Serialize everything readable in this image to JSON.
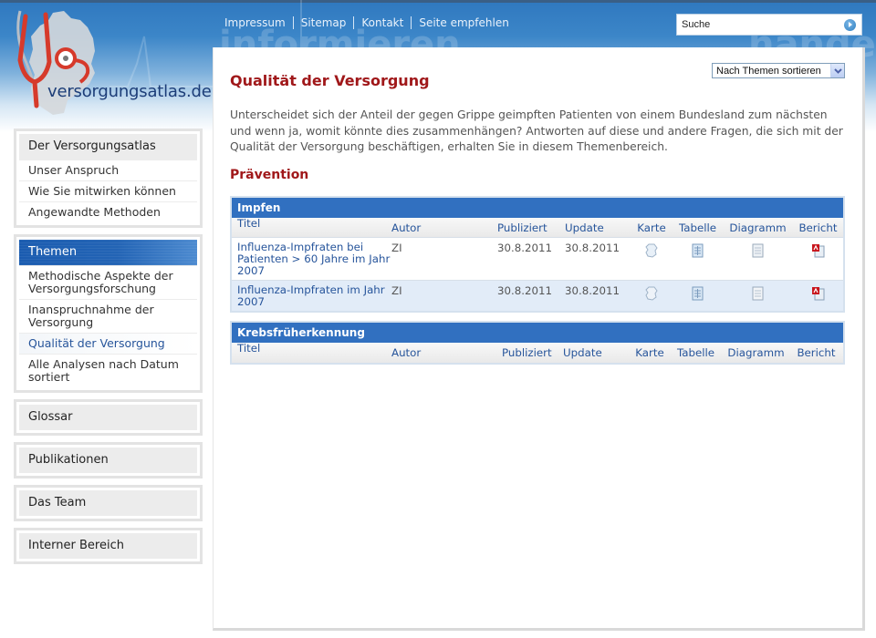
{
  "site": {
    "logo_text": "versorgungsatlas.de"
  },
  "topnav": {
    "links": [
      "Impressum",
      "Sitemap",
      "Kontakt",
      "Seite empfehlen"
    ]
  },
  "search": {
    "value": "Suche",
    "button_icon": "arrow-right-circle-icon"
  },
  "sidebar": {
    "box1": {
      "title": "Der Versorgungsatlas",
      "items": [
        "Unser Anspruch",
        "Wie Sie mitwirken können",
        "Angewandte Methoden"
      ]
    },
    "box2": {
      "title": "Themen",
      "items": [
        "Methodische Aspekte der Versorgungsforschung",
        "Inanspruchnahme der Versorgung",
        "Qualität der Versorgung",
        "Alle Analysen nach Datum sortiert"
      ],
      "current": "Qualität der Versorgung"
    },
    "single_boxes": [
      "Glossar",
      "Publikationen",
      "Das Team",
      "Interner Bereich"
    ]
  },
  "main": {
    "sort_select": "Nach Themen sortieren",
    "title": "Qualität der Versorgung",
    "intro": "Unterscheidet sich der Anteil der gegen Grippe geimpften Patienten von einem Bundesland zum nächsten und wenn ja, womit könnte dies zusammenhängen? Antworten auf diese und andere Fragen, die sich mit der Qualität der Versorgung beschäftigen, erhalten Sie in diesem Themenbereich.",
    "section": "Prävention",
    "columns": [
      "Titel",
      "Autor",
      "Publiziert",
      "Update",
      "Karte",
      "Tabelle",
      "Diagramm",
      "Bericht"
    ],
    "tables": [
      {
        "heading": "Impfen",
        "rows": [
          {
            "title": "Influenza-Impfraten bei Patienten > 60 Jahre im Jahr 2007",
            "autor": "ZI",
            "publiziert": "30.8.2011",
            "update": "30.8.2011"
          },
          {
            "title": "Influenza-Impfraten im Jahr 2007",
            "autor": "ZI",
            "publiziert": "30.8.2011",
            "update": "30.8.2011"
          }
        ]
      },
      {
        "heading": "Krebsfrüherkennung",
        "rows": []
      }
    ],
    "row_icons": {
      "karte": "map-icon",
      "tabelle": "table-document-icon",
      "diagramm": "chart-document-icon",
      "bericht": "pdf-report-icon"
    }
  },
  "colors": {
    "accent_red": "#a0181a",
    "link_blue": "#27559b",
    "table_header_blue": "#3170c0"
  }
}
